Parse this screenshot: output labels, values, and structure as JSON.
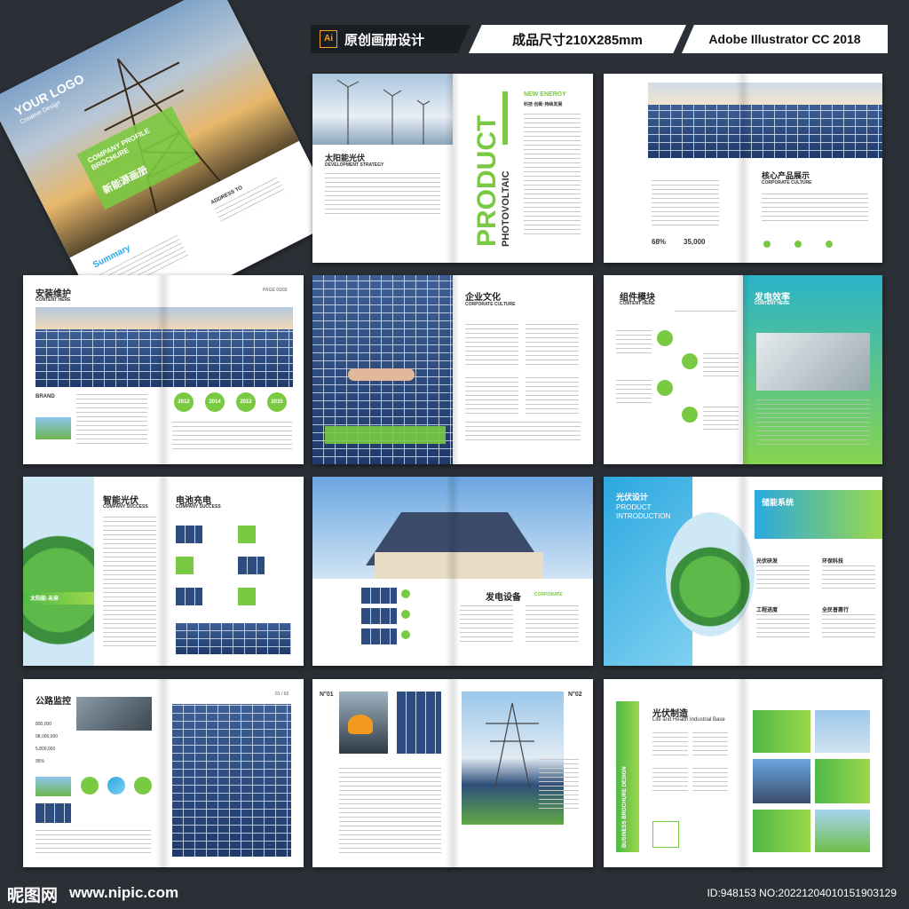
{
  "header": {
    "ai_icon": "Ai",
    "tag1": "原创画册设计",
    "tag2": "成品尺寸210X285mm",
    "tag3": "Adobe Illustrator CC 2018"
  },
  "cover": {
    "logo": "YOUR LOGO",
    "logo_sub": "Creative Design",
    "brochure_title": "COMPANY PROFILE BROCHURE",
    "cn_title": "新能源画册",
    "summary": "Summary",
    "address": "ADDRESS TO"
  },
  "spread1": {
    "title": "太阳能光伏",
    "subtitle": "DEVELOPMENT STRATEGY",
    "vertical1": "PRODUCT",
    "vertical2": "PHOTOVOLTAIC",
    "right_title": "NEW ENERGY",
    "right_sub": "科技·创新·持续发展"
  },
  "spread2": {
    "title": "核心产品展示",
    "subtitle": "CORPORATE CULTURE",
    "stat1": "68%",
    "stat2": "35,000"
  },
  "spread3": {
    "title": "安装维护",
    "subtitle": "CONTENT HERE",
    "page": "PAGE 01/02",
    "brand": "BRAND",
    "years": [
      "2012",
      "2014",
      "2022",
      "2035"
    ]
  },
  "spread4": {
    "title": "企业文化",
    "subtitle": "CORPORATE CULTURE"
  },
  "spread5": {
    "title_left": "组件模块",
    "sub_left": "CONTENT HERE",
    "title_right": "发电效率",
    "sub_right": "CONTENT HERE"
  },
  "spread6": {
    "title_left": "智能光伏",
    "sub_left": "COMPANY SUCCESS",
    "caption": "太阳能·未来",
    "title_right": "电池充电",
    "sub_right": "COMPANY SUCCESS"
  },
  "spread7": {
    "title": "发电设备",
    "subtitle": "CORPORATE"
  },
  "spread8": {
    "title_left": "光伏设计",
    "sub_left1": "PRODUCT",
    "sub_left2": "INTRODUCTION",
    "title_right": "储能系统",
    "items": [
      "光伏研发",
      "环保科技",
      "工程进度",
      "全民普惠行"
    ]
  },
  "spread9": {
    "title": "公路监控",
    "page": "01 / 02",
    "stats": [
      "800,000",
      "98,000,000",
      "5,800,000",
      "95%"
    ]
  },
  "spread10": {
    "left_no": "N°01",
    "right_no": "N°02"
  },
  "spread11": {
    "vertical": "BUSINESS BROCHURE DESIGN",
    "title": "光伏制造",
    "subtitle": "Life and Health Industrial Base"
  },
  "footer": {
    "site_logo": "昵图网",
    "site_url": "www.nipic.com",
    "id_text": "ID:948153 NO:20221204010151903129"
  },
  "colors": {
    "background": "#2b3036",
    "accent_green": "#7ac943",
    "accent_blue": "#2ba8e0"
  }
}
